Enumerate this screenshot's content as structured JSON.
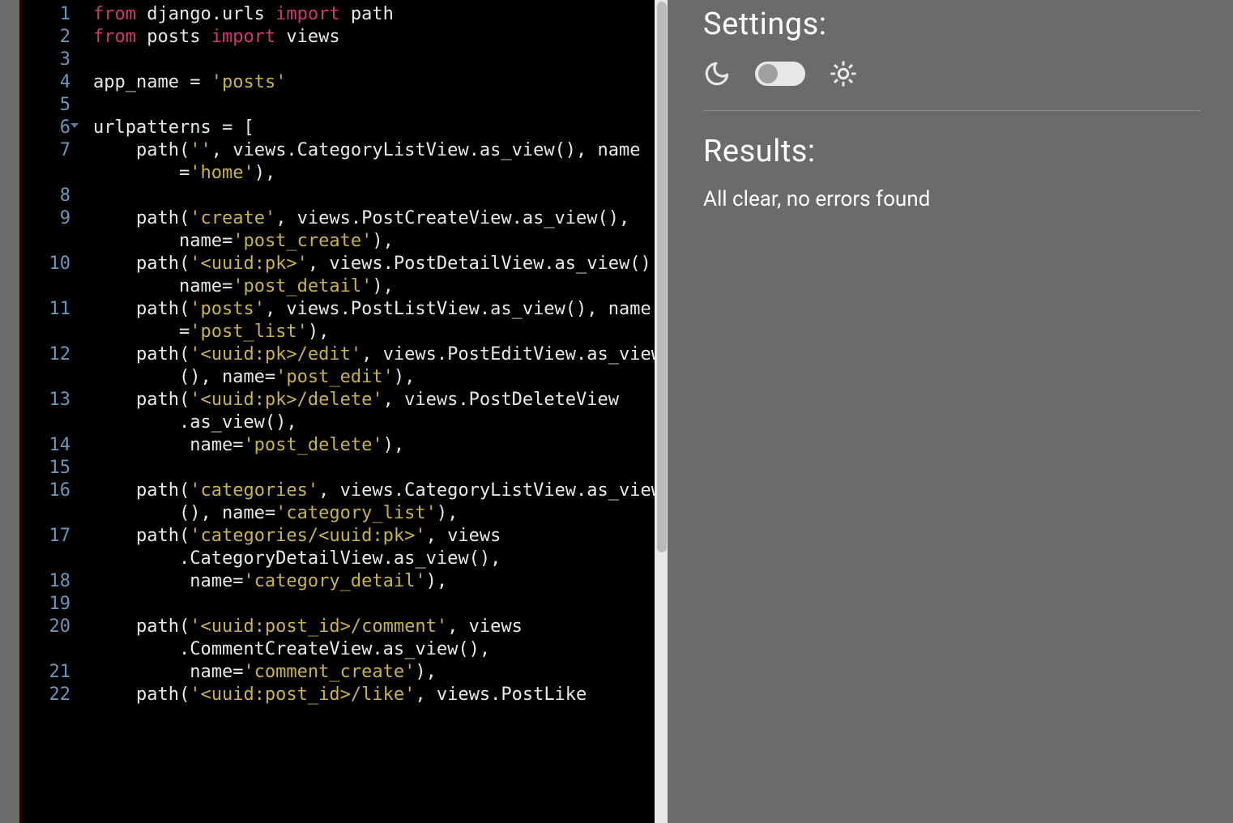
{
  "sidebar": {
    "settings_title": "Settings:",
    "results_title": "Results:",
    "results_text": "All clear, no errors found",
    "theme_toggle_state": "off"
  },
  "editor": {
    "line_numbers": [
      1,
      2,
      3,
      4,
      5,
      6,
      7,
      8,
      9,
      10,
      11,
      12,
      13,
      14,
      15,
      16,
      17,
      18,
      19,
      20,
      21,
      22
    ],
    "fold_line": 6,
    "code_lines": [
      [
        [
          "kw",
          "from"
        ],
        [
          "pl",
          " django.urls "
        ],
        [
          "kw",
          "import"
        ],
        [
          "pl",
          " path"
        ]
      ],
      [
        [
          "kw",
          "from"
        ],
        [
          "pl",
          " posts "
        ],
        [
          "kw",
          "import"
        ],
        [
          "pl",
          " views"
        ]
      ],
      [],
      [
        [
          "pl",
          "app_name "
        ],
        [
          "op",
          "="
        ],
        [
          "pl",
          " "
        ],
        [
          "str",
          "'posts'"
        ]
      ],
      [],
      [
        [
          "pl",
          "urlpatterns "
        ],
        [
          "op",
          "="
        ],
        [
          "pl",
          " ["
        ]
      ],
      [
        [
          "pl",
          "    path("
        ],
        [
          "str",
          "''"
        ],
        [
          "pl",
          ", views.CategoryListView.as_view(), name"
        ]
      ],
      [
        [
          "pl",
          "        "
        ],
        [
          "op",
          "="
        ],
        [
          "str",
          "'home'"
        ],
        [
          "pl",
          "),"
        ]
      ],
      [],
      [
        [
          "pl",
          "    path("
        ],
        [
          "str",
          "'create'"
        ],
        [
          "pl",
          ", views.PostCreateView.as_view(),"
        ]
      ],
      [
        [
          "pl",
          "        name"
        ],
        [
          "op",
          "="
        ],
        [
          "str",
          "'post_create'"
        ],
        [
          "pl",
          "),"
        ]
      ],
      [
        [
          "pl",
          "    path("
        ],
        [
          "str",
          "'<uuid:pk>'"
        ],
        [
          "pl",
          ", views.PostDetailView.as_view(),"
        ]
      ],
      [
        [
          "pl",
          "        name"
        ],
        [
          "op",
          "="
        ],
        [
          "str",
          "'post_detail'"
        ],
        [
          "pl",
          "),"
        ]
      ],
      [
        [
          "pl",
          "    path("
        ],
        [
          "str",
          "'posts'"
        ],
        [
          "pl",
          ", views.PostListView.as_view(), name"
        ]
      ],
      [
        [
          "pl",
          "        "
        ],
        [
          "op",
          "="
        ],
        [
          "str",
          "'post_list'"
        ],
        [
          "pl",
          "),"
        ]
      ],
      [
        [
          "pl",
          "    path("
        ],
        [
          "str",
          "'<uuid:pk>/edit'"
        ],
        [
          "pl",
          ", views.PostEditView.as_view"
        ]
      ],
      [
        [
          "pl",
          "        (), name"
        ],
        [
          "op",
          "="
        ],
        [
          "str",
          "'post_edit'"
        ],
        [
          "pl",
          "),"
        ]
      ],
      [
        [
          "pl",
          "    path("
        ],
        [
          "str",
          "'<uuid:pk>/delete'"
        ],
        [
          "pl",
          ", views.PostDeleteView"
        ]
      ],
      [
        [
          "pl",
          "        .as_view(),"
        ]
      ],
      [
        [
          "pl",
          "         name"
        ],
        [
          "op",
          "="
        ],
        [
          "str",
          "'post_delete'"
        ],
        [
          "pl",
          "),"
        ]
      ],
      [],
      [
        [
          "pl",
          "    path("
        ],
        [
          "str",
          "'categories'"
        ],
        [
          "pl",
          ", views.CategoryListView.as_view"
        ]
      ],
      [
        [
          "pl",
          "        (), name"
        ],
        [
          "op",
          "="
        ],
        [
          "str",
          "'category_list'"
        ],
        [
          "pl",
          "),"
        ]
      ],
      [
        [
          "pl",
          "    path("
        ],
        [
          "str",
          "'categories/<uuid:pk>'"
        ],
        [
          "pl",
          ", views"
        ]
      ],
      [
        [
          "pl",
          "        .CategoryDetailView.as_view(),"
        ]
      ],
      [
        [
          "pl",
          "         name"
        ],
        [
          "op",
          "="
        ],
        [
          "str",
          "'category_detail'"
        ],
        [
          "pl",
          "),"
        ]
      ],
      [],
      [
        [
          "pl",
          "    path("
        ],
        [
          "str",
          "'<uuid:post_id>/comment'"
        ],
        [
          "pl",
          ", views"
        ]
      ],
      [
        [
          "pl",
          "        .CommentCreateView.as_view(),"
        ]
      ],
      [
        [
          "pl",
          "         name"
        ],
        [
          "op",
          "="
        ],
        [
          "str",
          "'comment_create'"
        ],
        [
          "pl",
          "),"
        ]
      ],
      [
        [
          "pl",
          "    path("
        ],
        [
          "str",
          "'<uuid:post_id>/like'"
        ],
        [
          "pl",
          ", views.PostLike"
        ]
      ]
    ],
    "physical_to_logical": [
      1,
      2,
      3,
      4,
      5,
      6,
      7,
      7,
      8,
      9,
      9,
      10,
      10,
      11,
      11,
      12,
      12,
      13,
      13,
      14,
      15,
      16,
      16,
      17,
      17,
      18,
      19,
      20,
      20,
      21,
      22
    ]
  },
  "colors": {
    "keyword": "#c83b72",
    "string": "#c9b24a",
    "plain": "#e8e8e8",
    "linenum": "#6897bb",
    "bg_editor": "#000000",
    "bg_app": "#6b6b6b"
  }
}
